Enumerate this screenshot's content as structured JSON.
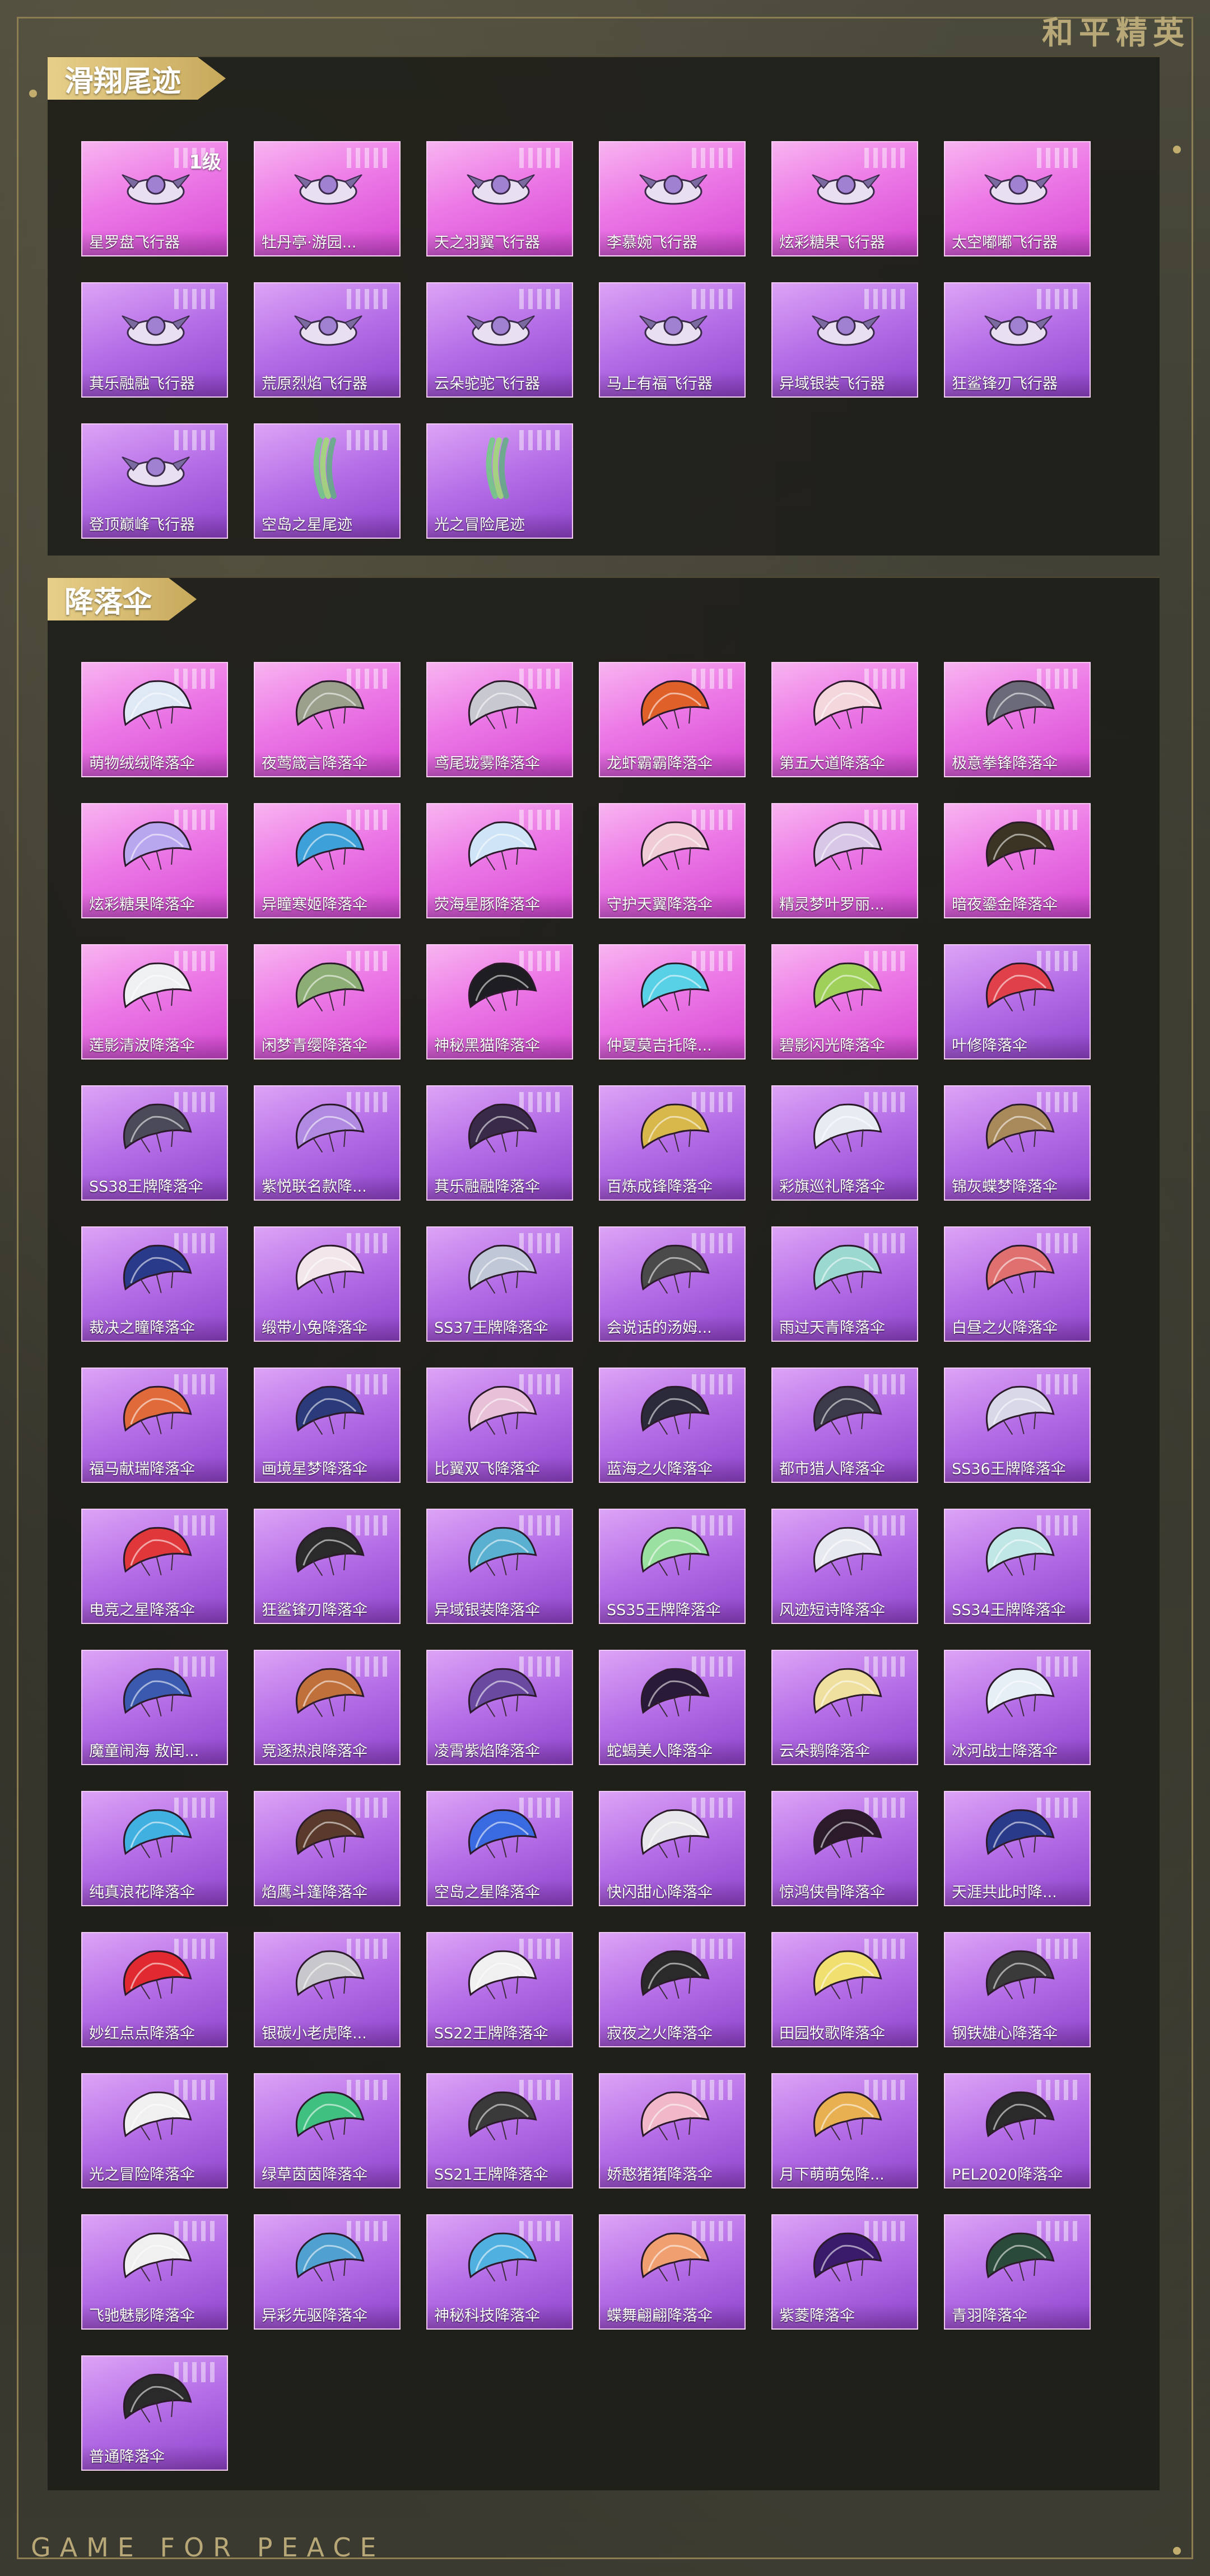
{
  "brand": "和平精英",
  "footer": "GAME FOR PEACE",
  "sections": [
    {
      "title": "滑翔尾迹",
      "items": [
        {
          "label": "星罗盘飞行器",
          "rarity": "pink",
          "icon": "glider-icon",
          "level": "1级"
        },
        {
          "label": "牡丹亭·游园...",
          "rarity": "pink",
          "icon": "glider-icon"
        },
        {
          "label": "天之羽翼飞行器",
          "rarity": "pink",
          "icon": "glider-icon"
        },
        {
          "label": "李慕婉飞行器",
          "rarity": "pink",
          "icon": "glider-icon"
        },
        {
          "label": "炫彩糖果飞行器",
          "rarity": "pink",
          "icon": "glider-icon"
        },
        {
          "label": "太空嘟嘟飞行器",
          "rarity": "pink",
          "icon": "glider-icon"
        },
        {
          "label": "萁乐融融飞行器",
          "rarity": "purple",
          "icon": "glider-icon"
        },
        {
          "label": "荒原烈焰飞行器",
          "rarity": "purple",
          "icon": "glider-icon"
        },
        {
          "label": "云朵驼驼飞行器",
          "rarity": "purple",
          "icon": "glider-icon"
        },
        {
          "label": "马上有福飞行器",
          "rarity": "purple",
          "icon": "glider-icon"
        },
        {
          "label": "异域银装飞行器",
          "rarity": "purple",
          "icon": "glider-icon"
        },
        {
          "label": "狂鲨锋刃飞行器",
          "rarity": "purple",
          "icon": "glider-icon"
        },
        {
          "label": "登顶巅峰飞行器",
          "rarity": "purple",
          "icon": "glider-icon"
        },
        {
          "label": "空岛之星尾迹",
          "rarity": "purple",
          "icon": "trail-icon"
        },
        {
          "label": "光之冒险尾迹",
          "rarity": "purple",
          "icon": "trail-icon"
        }
      ]
    },
    {
      "title": "降落伞",
      "items": [
        {
          "label": "萌物绒绒降落伞",
          "rarity": "pink",
          "icon": "parachute-icon",
          "color": "#dfe9f6"
        },
        {
          "label": "夜莺箴言降落伞",
          "rarity": "pink",
          "icon": "parachute-icon",
          "color": "#9aa08c"
        },
        {
          "label": "鸢尾珑雾降落伞",
          "rarity": "pink",
          "icon": "parachute-icon",
          "color": "#c8c8d0"
        },
        {
          "label": "龙虾霸霸降落伞",
          "rarity": "pink",
          "icon": "parachute-icon",
          "color": "#e0602a"
        },
        {
          "label": "第五大道降落伞",
          "rarity": "pink",
          "icon": "parachute-icon",
          "color": "#f3d7dc"
        },
        {
          "label": "极意拳锋降落伞",
          "rarity": "pink",
          "icon": "parachute-icon",
          "color": "#6a6a78"
        },
        {
          "label": "炫彩糖果降落伞",
          "rarity": "pink",
          "icon": "parachute-icon",
          "color": "#b8a6ef"
        },
        {
          "label": "异瞳寒姬降落伞",
          "rarity": "pink",
          "icon": "parachute-icon",
          "color": "#3ea0d8"
        },
        {
          "label": "荧海星豚降落伞",
          "rarity": "pink",
          "icon": "parachute-icon",
          "color": "#cfe4f6"
        },
        {
          "label": "守护天翼降落伞",
          "rarity": "pink",
          "icon": "parachute-icon",
          "color": "#f0ccd6"
        },
        {
          "label": "精灵梦叶罗丽...",
          "rarity": "pink",
          "icon": "parachute-icon",
          "color": "#d8c7e6"
        },
        {
          "label": "暗夜鎏金降落伞",
          "rarity": "pink",
          "icon": "parachute-icon",
          "color": "#3b3424"
        },
        {
          "label": "莲影清波降落伞",
          "rarity": "pink",
          "icon": "parachute-icon",
          "color": "#eef0f2"
        },
        {
          "label": "闲梦青缨降落伞",
          "rarity": "pink",
          "icon": "parachute-icon",
          "color": "#8cae74"
        },
        {
          "label": "神秘黑猫降落伞",
          "rarity": "pink",
          "icon": "parachute-icon",
          "color": "#1e1e22"
        },
        {
          "label": "仲夏莫吉托降...",
          "rarity": "pink",
          "icon": "parachute-icon",
          "color": "#58d0e6"
        },
        {
          "label": "碧影闪光降落伞",
          "rarity": "pink",
          "icon": "parachute-icon",
          "color": "#9ed05a"
        },
        {
          "label": "叶修降落伞",
          "rarity": "purple",
          "icon": "parachute-icon",
          "color": "#e0404a"
        },
        {
          "label": "SS38王牌降落伞",
          "rarity": "purple",
          "icon": "parachute-icon",
          "color": "#4a4a58"
        },
        {
          "label": "紫悦联名款降...",
          "rarity": "purple",
          "icon": "parachute-icon",
          "color": "#b08ae0"
        },
        {
          "label": "萁乐融融降落伞",
          "rarity": "purple",
          "icon": "parachute-icon",
          "color": "#3a2a4a"
        },
        {
          "label": "百炼成锋降落伞",
          "rarity": "purple",
          "icon": "parachute-icon",
          "color": "#d8b84a"
        },
        {
          "label": "彩旗巡礼降落伞",
          "rarity": "purple",
          "icon": "parachute-icon",
          "color": "#e6ecf2"
        },
        {
          "label": "锦灰蝶梦降落伞",
          "rarity": "purple",
          "icon": "parachute-icon",
          "color": "#a88a5a"
        },
        {
          "label": "裁决之瞳降落伞",
          "rarity": "purple",
          "icon": "parachute-icon",
          "color": "#2a3a8a"
        },
        {
          "label": "缎带小兔降落伞",
          "rarity": "purple",
          "icon": "parachute-icon",
          "color": "#f2e6ea"
        },
        {
          "label": "SS37王牌降落伞",
          "rarity": "purple",
          "icon": "parachute-icon",
          "color": "#c0c8d8"
        },
        {
          "label": "会说话的汤姆...",
          "rarity": "purple",
          "icon": "parachute-icon",
          "color": "#4a4a4a"
        },
        {
          "label": "雨过天青降落伞",
          "rarity": "purple",
          "icon": "parachute-icon",
          "color": "#9ad8d0"
        },
        {
          "label": "白昼之火降落伞",
          "rarity": "purple",
          "icon": "parachute-icon",
          "color": "#e07070"
        },
        {
          "label": "福马献瑞降落伞",
          "rarity": "purple",
          "icon": "parachute-icon",
          "color": "#e06a3a"
        },
        {
          "label": "画境星梦降落伞",
          "rarity": "purple",
          "icon": "parachute-icon",
          "color": "#2a3a7a"
        },
        {
          "label": "比翼双飞降落伞",
          "rarity": "purple",
          "icon": "parachute-icon",
          "color": "#e8c0d8"
        },
        {
          "label": "蓝海之火降落伞",
          "rarity": "purple",
          "icon": "parachute-icon",
          "color": "#2a2a3a"
        },
        {
          "label": "都市猎人降落伞",
          "rarity": "purple",
          "icon": "parachute-icon",
          "color": "#3a3a4a"
        },
        {
          "label": "SS36王牌降落伞",
          "rarity": "purple",
          "icon": "parachute-icon",
          "color": "#d8d8e8"
        },
        {
          "label": "电竞之星降落伞",
          "rarity": "purple",
          "icon": "parachute-icon",
          "color": "#e0383a"
        },
        {
          "label": "狂鲨锋刃降落伞",
          "rarity": "purple",
          "icon": "parachute-icon",
          "color": "#2a2a2a"
        },
        {
          "label": "异域银装降落伞",
          "rarity": "purple",
          "icon": "parachute-icon",
          "color": "#5ab0d0"
        },
        {
          "label": "SS35王牌降落伞",
          "rarity": "purple",
          "icon": "parachute-icon",
          "color": "#9ae0a0"
        },
        {
          "label": "风迹短诗降落伞",
          "rarity": "purple",
          "icon": "parachute-icon",
          "color": "#e6eaf0"
        },
        {
          "label": "SS34王牌降落伞",
          "rarity": "purple",
          "icon": "parachute-icon",
          "color": "#c0e6e6"
        },
        {
          "label": "魔童闹海 敖闰...",
          "rarity": "purple",
          "icon": "parachute-icon",
          "color": "#3a5ab0"
        },
        {
          "label": "竞逐热浪降落伞",
          "rarity": "purple",
          "icon": "parachute-icon",
          "color": "#c0703a"
        },
        {
          "label": "凌霄紫焰降落伞",
          "rarity": "purple",
          "icon": "parachute-icon",
          "color": "#6a4aa0"
        },
        {
          "label": "蛇蝎美人降落伞",
          "rarity": "purple",
          "icon": "parachute-icon",
          "color": "#2a1a3a"
        },
        {
          "label": "云朵鹅降落伞",
          "rarity": "purple",
          "icon": "parachute-icon",
          "color": "#f0e0a0"
        },
        {
          "label": "冰河战士降落伞",
          "rarity": "purple",
          "icon": "parachute-icon",
          "color": "#e6eef6"
        },
        {
          "label": "纯真浪花降落伞",
          "rarity": "purple",
          "icon": "parachute-icon",
          "color": "#40b0e0"
        },
        {
          "label": "焰鹰斗篷降落伞",
          "rarity": "purple",
          "icon": "parachute-icon",
          "color": "#5a3a2a"
        },
        {
          "label": "空岛之星降落伞",
          "rarity": "purple",
          "icon": "parachute-icon",
          "color": "#3a6ae0"
        },
        {
          "label": "快闪甜心降落伞",
          "rarity": "purple",
          "icon": "parachute-icon",
          "color": "#e8e8ec"
        },
        {
          "label": "惊鸿侠骨降落伞",
          "rarity": "purple",
          "icon": "parachute-icon",
          "color": "#2a1a2a"
        },
        {
          "label": "天涯共此时降...",
          "rarity": "purple",
          "icon": "parachute-icon",
          "color": "#2a3a8a"
        },
        {
          "label": "妙红点点降落伞",
          "rarity": "purple",
          "icon": "parachute-icon",
          "color": "#e02a30"
        },
        {
          "label": "银碳小老虎降...",
          "rarity": "purple",
          "icon": "parachute-icon",
          "color": "#c8c8cc"
        },
        {
          "label": "SS22王牌降落伞",
          "rarity": "purple",
          "icon": "parachute-icon",
          "color": "#f0f0f0"
        },
        {
          "label": "寂夜之火降落伞",
          "rarity": "purple",
          "icon": "parachute-icon",
          "color": "#2a2a2a"
        },
        {
          "label": "田园牧歌降落伞",
          "rarity": "purple",
          "icon": "parachute-icon",
          "color": "#f0e070"
        },
        {
          "label": "钢铁雄心降落伞",
          "rarity": "purple",
          "icon": "parachute-icon",
          "color": "#3a3a3a"
        },
        {
          "label": "光之冒险降落伞",
          "rarity": "purple",
          "icon": "parachute-icon",
          "color": "#f0f0f0"
        },
        {
          "label": "绿草茵茵降落伞",
          "rarity": "purple",
          "icon": "parachute-icon",
          "color": "#40c080"
        },
        {
          "label": "SS21王牌降落伞",
          "rarity": "purple",
          "icon": "parachute-icon",
          "color": "#3a3a3a"
        },
        {
          "label": "娇憨猪猪降落伞",
          "rarity": "purple",
          "icon": "parachute-icon",
          "color": "#f0b8c8"
        },
        {
          "label": "月下萌萌兔降...",
          "rarity": "purple",
          "icon": "parachute-icon",
          "color": "#e8b050"
        },
        {
          "label": "PEL2020降落伞",
          "rarity": "purple",
          "icon": "parachute-icon",
          "color": "#2a2a2a"
        },
        {
          "label": "飞驰魅影降落伞",
          "rarity": "purple",
          "icon": "parachute-icon",
          "color": "#f0f0f0"
        },
        {
          "label": "异彩先驱降落伞",
          "rarity": "purple",
          "icon": "parachute-icon",
          "color": "#50a0d0"
        },
        {
          "label": "神秘科技降落伞",
          "rarity": "purple",
          "icon": "parachute-icon",
          "color": "#50b0e0"
        },
        {
          "label": "蝶舞翩翩降落伞",
          "rarity": "purple",
          "icon": "parachute-icon",
          "color": "#f0a070"
        },
        {
          "label": "紫菱降落伞",
          "rarity": "purple",
          "icon": "parachute-icon",
          "color": "#3a1a6a"
        },
        {
          "label": "青羽降落伞",
          "rarity": "purple",
          "icon": "parachute-icon",
          "color": "#2a4a3a"
        },
        {
          "label": "普通降落伞",
          "rarity": "purple",
          "icon": "parachute-icon",
          "color": "#2a2a2a"
        }
      ]
    }
  ]
}
